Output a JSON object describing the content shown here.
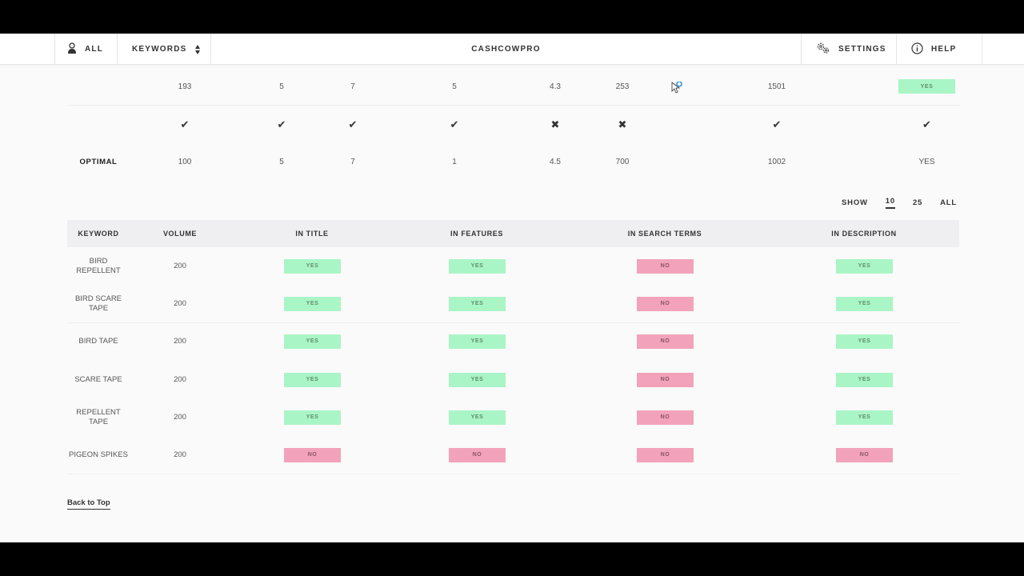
{
  "nav": {
    "all_label": "ALL",
    "keywords_label": "KEYWORDS",
    "brand": "CASHCOWPRO",
    "settings_label": "SETTINGS",
    "help_label": "HELP"
  },
  "summary": {
    "current_row": [
      "193",
      "5",
      "7",
      "5",
      "4.3",
      "253",
      "1501"
    ],
    "current_badge": "YES",
    "status_marks": [
      "check",
      "check",
      "check",
      "check",
      "cross",
      "cross",
      "check",
      "check"
    ],
    "optimal_label": "OPTIMAL",
    "optimal_row": [
      "100",
      "5",
      "7",
      "1",
      "4.5",
      "700",
      "1002",
      "YES"
    ]
  },
  "pagination": {
    "show_label": "SHOW",
    "options": [
      "10",
      "25",
      "ALL"
    ],
    "selected": "10"
  },
  "keywords_table": {
    "headers": [
      "KEYWORD",
      "VOLUME",
      "IN TITLE",
      "IN FEATURES",
      "IN SEARCH TERMS",
      "IN DESCRIPTION"
    ],
    "rows": [
      {
        "keyword": "BIRD REPELLENT",
        "volume": "200",
        "in_title": "YES",
        "in_features": "YES",
        "in_search_terms": "NO",
        "in_description": "YES"
      },
      {
        "keyword": "BIRD SCARE TAPE",
        "volume": "200",
        "in_title": "YES",
        "in_features": "YES",
        "in_search_terms": "NO",
        "in_description": "YES"
      },
      {
        "keyword": "BIRD TAPE",
        "volume": "200",
        "in_title": "YES",
        "in_features": "YES",
        "in_search_terms": "NO",
        "in_description": "YES"
      },
      {
        "keyword": "SCARE TAPE",
        "volume": "200",
        "in_title": "YES",
        "in_features": "YES",
        "in_search_terms": "NO",
        "in_description": "YES"
      },
      {
        "keyword": "REPELLENT TAPE",
        "volume": "200",
        "in_title": "YES",
        "in_features": "YES",
        "in_search_terms": "NO",
        "in_description": "YES"
      },
      {
        "keyword": "PIGEON SPIKES",
        "volume": "200",
        "in_title": "NO",
        "in_features": "NO",
        "in_search_terms": "NO",
        "in_description": "NO"
      }
    ]
  },
  "footer": {
    "back_to_top": "Back to Top"
  },
  "colors": {
    "yes_badge": "#aaf5c6",
    "no_badge": "#f2a3bb",
    "table_header": "#efeff1"
  },
  "icons": {
    "all": "user-icon",
    "sort": "sort-arrows-icon",
    "settings": "gears-icon",
    "help": "info-icon",
    "check": "check-icon",
    "cross": "cross-icon"
  }
}
